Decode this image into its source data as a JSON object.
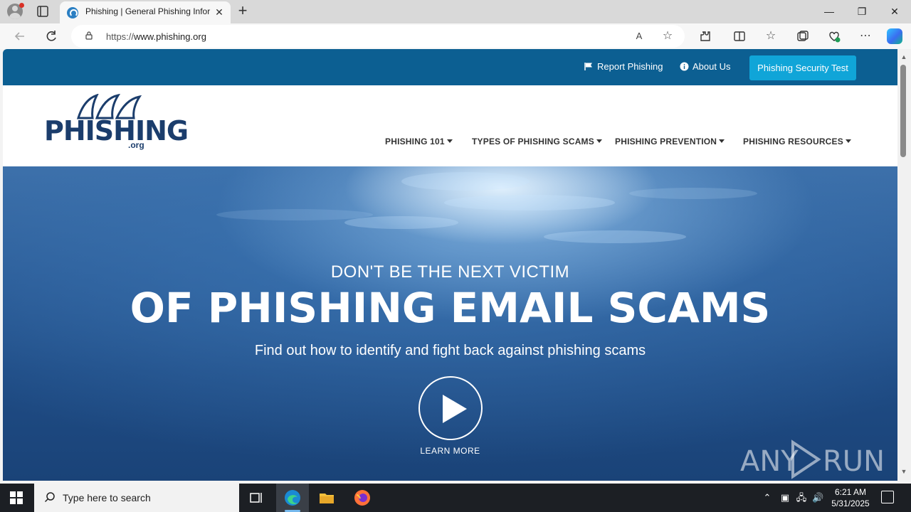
{
  "browser": {
    "tab": {
      "title": "Phishing | General Phishing Information",
      "favicon": "phishing-org-favicon"
    },
    "address": {
      "scheme": "https://",
      "host": "www.phishing.org"
    },
    "icons": [
      "back-icon",
      "refresh-icon",
      "lock-icon",
      "read-aloud-icon",
      "favorite-star-icon",
      "extensions-icon",
      "split-screen-icon",
      "favorites-icon",
      "collections-icon",
      "browser-essentials-icon",
      "more-icon",
      "copilot-icon"
    ]
  },
  "site": {
    "topbar": {
      "report_label": "Report Phishing",
      "about_label": "About Us",
      "cta_label": "Phishing Security Test"
    },
    "logo": {
      "text": "PHISHING",
      "suffix": ".org"
    },
    "nav": [
      {
        "label": "PHISHING 101"
      },
      {
        "label": "TYPES OF PHISHING SCAMS"
      },
      {
        "label": "PHISHING PREVENTION"
      },
      {
        "label": "PHISHING RESOURCES"
      }
    ],
    "hero": {
      "subtitle": "DON'T BE THE NEXT VICTIM",
      "title": "OF PHISHING EMAIL SCAMS",
      "description": "Find out how to identify and fight back against phishing scams",
      "learn_more": "LEARN MORE",
      "watermark": "ANY RUN"
    }
  },
  "taskbar": {
    "search_placeholder": "Type here to search",
    "time": "6:21 AM",
    "date": "5/31/2025"
  },
  "colors": {
    "topbar": "#0c5f92",
    "cta": "#10a5d8",
    "logo": "#1b3d6c"
  }
}
